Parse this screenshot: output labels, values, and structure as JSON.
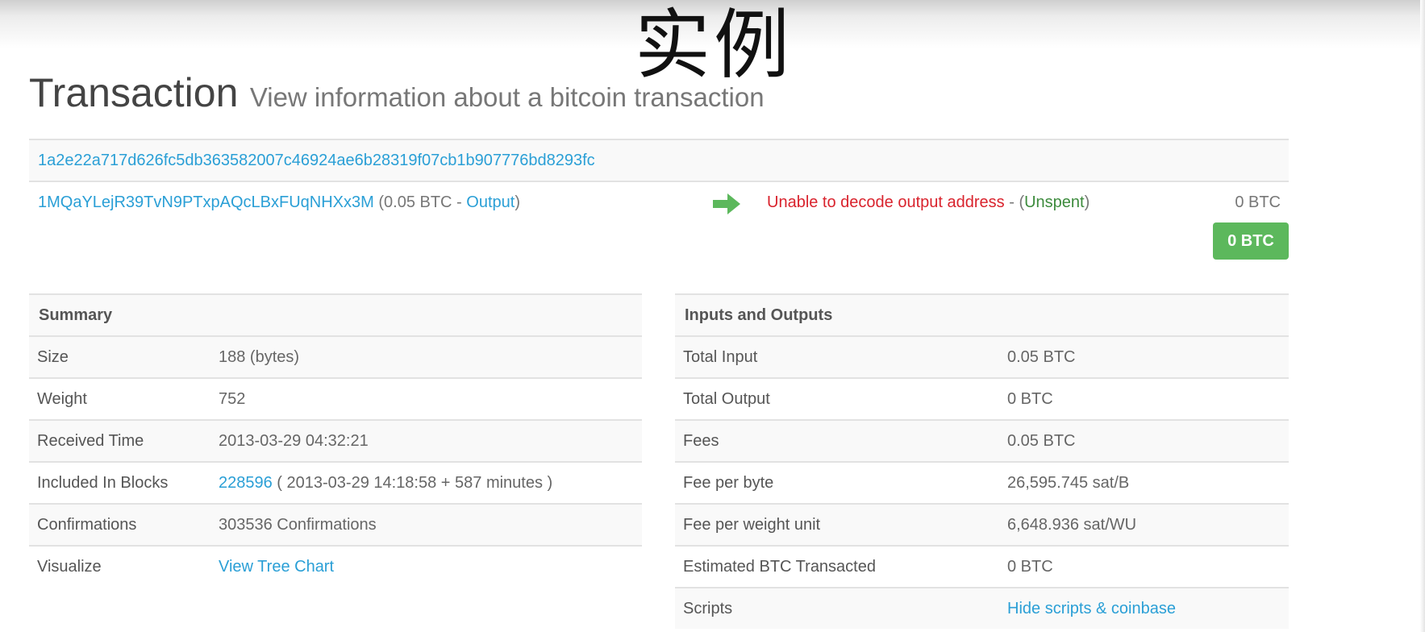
{
  "caption": "实例",
  "header": {
    "title": "Transaction",
    "subtitle": "View information about a bitcoin transaction"
  },
  "transaction": {
    "hash": "1a2e22a717d626fc5db363582007c46924ae6b28319f07cb1b907776bd8293fc",
    "input": {
      "address": "1MQaYLejR39TvN9PTxpAQcLBxFUqNHXx3M",
      "prefix": "(0.05 BTC - ",
      "link_label": "Output",
      "suffix": ")"
    },
    "output": {
      "text": "Unable to decode output address",
      "sep": " - (",
      "status": "Unspent",
      "close": ")",
      "amount": "0 BTC"
    },
    "total_badge": "0 BTC"
  },
  "summary": {
    "title": "Summary",
    "rows": [
      {
        "label": "Size",
        "value": "188 (bytes)"
      },
      {
        "label": "Weight",
        "value": "752"
      },
      {
        "label": "Received Time",
        "value": "2013-03-29 04:32:21"
      },
      {
        "label": "Included In Blocks",
        "block": "228596",
        "value": " ( 2013-03-29 14:18:58 + 587 minutes )"
      },
      {
        "label": "Confirmations",
        "value": "303536 Confirmations"
      },
      {
        "label": "Visualize",
        "value": "View Tree Chart"
      }
    ]
  },
  "io": {
    "title": "Inputs and Outputs",
    "rows": [
      {
        "label": "Total Input",
        "value": "0.05 BTC"
      },
      {
        "label": "Total Output",
        "value": "0 BTC"
      },
      {
        "label": "Fees",
        "value": "0.05 BTC"
      },
      {
        "label": "Fee per byte",
        "value": "26,595.745 sat/B"
      },
      {
        "label": "Fee per weight unit",
        "value": "6,648.936 sat/WU"
      },
      {
        "label": "Estimated BTC Transacted",
        "value": "0 BTC"
      },
      {
        "label": "Scripts",
        "value": "Hide scripts & coinbase"
      }
    ]
  },
  "colors": {
    "link": "#2a9fd6",
    "error": "#d9232d",
    "success": "#5cb85c",
    "unspent": "#3d8b3d"
  }
}
